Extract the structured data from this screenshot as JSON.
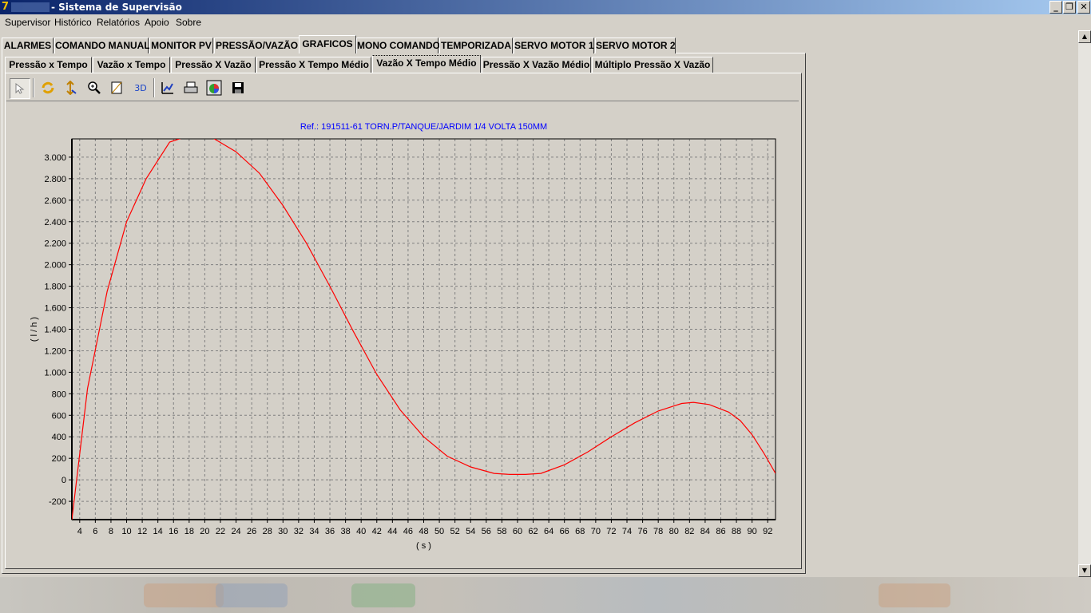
{
  "window": {
    "title": "- Sistema de Supervisão",
    "logo": "7"
  },
  "menu": [
    "Supervisor",
    "Histórico",
    "Relatórios",
    "Apoio",
    "Sobre"
  ],
  "tabs": [
    "ALARMES",
    "COMANDO MANUAL",
    "MONITOR PV",
    "PRESSÃO/VAZÃO",
    "GRAFICOS",
    "MONO COMANDO",
    "TEMPORIZADA",
    "SERVO MOTOR 1",
    "SERVO MOTOR 2"
  ],
  "active_tab": "GRAFICOS",
  "subtabs": [
    "Pressão x Tempo",
    "Vazão x Tempo",
    "Pressão X Vazão",
    "Pressão X Tempo Médio",
    "Vazão X Tempo Médio",
    "Pressão X Vazão Médio",
    "Múltiplo Pressão X Vazão"
  ],
  "active_subtab": "Vazão X Tempo Médio",
  "toolbar": {
    "icons": [
      "pointer-icon",
      "rotate-icon",
      "move-icon",
      "zoom-icon",
      "depth-icon",
      "3d-icon",
      "edit-chart-icon",
      "print-icon",
      "export-image-icon",
      "save-icon"
    ],
    "label_3d": "3D"
  },
  "colors": {
    "title": "#0000ff",
    "series": "#ff0000",
    "titlebar_start": "#0a246a",
    "titlebar_end": "#a6caf0"
  },
  "chart_data": {
    "type": "line",
    "title": "Ref.: 191511-61   TORN.P/TANQUE/JARDIM 1/4 VOLTA 150MM",
    "xlabel": "( s )",
    "ylabel": "( l / h )",
    "xlim": [
      3,
      93
    ],
    "ylim": [
      -370,
      3170
    ],
    "xticks": [
      4,
      6,
      8,
      10,
      12,
      14,
      16,
      18,
      20,
      22,
      24,
      26,
      28,
      30,
      32,
      34,
      36,
      38,
      40,
      42,
      44,
      46,
      48,
      50,
      52,
      54,
      56,
      58,
      60,
      62,
      64,
      66,
      68,
      70,
      72,
      74,
      76,
      78,
      80,
      82,
      84,
      86,
      88,
      90,
      92
    ],
    "yticks": [
      -200,
      0,
      200,
      400,
      600,
      800,
      1000,
      1200,
      1400,
      1600,
      1800,
      2000,
      2200,
      2400,
      2600,
      2800,
      3000
    ],
    "ytick_labels": [
      "-200",
      "0",
      "200",
      "400",
      "600",
      "800",
      "1.000",
      "1.200",
      "1.400",
      "1.600",
      "1.800",
      "2.000",
      "2.200",
      "2.400",
      "2.600",
      "2.800",
      "3.000"
    ],
    "grid": true,
    "series": [
      {
        "x": [
          3,
          5,
          7.5,
          10,
          12.5,
          15.5,
          18,
          21,
          24,
          27,
          30,
          33,
          36,
          39,
          42,
          45,
          48,
          51,
          54,
          57,
          59,
          61,
          63,
          66,
          69,
          72,
          75,
          78,
          81,
          82.5,
          84.5,
          87,
          88.5,
          90,
          91.5,
          93
        ],
        "y": [
          -370,
          850,
          1750,
          2400,
          2800,
          3140,
          3200,
          3180,
          3050,
          2850,
          2550,
          2200,
          1800,
          1380,
          980,
          650,
          400,
          220,
          120,
          60,
          50,
          50,
          60,
          140,
          260,
          400,
          530,
          640,
          710,
          720,
          700,
          630,
          550,
          420,
          250,
          60
        ]
      }
    ]
  }
}
